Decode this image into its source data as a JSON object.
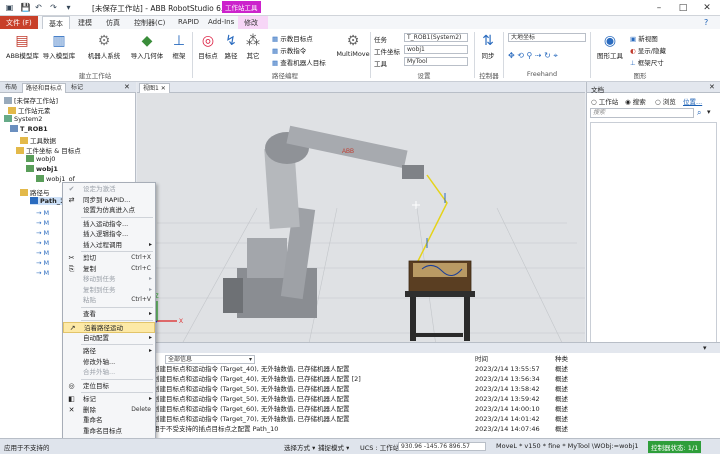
{
  "window": {
    "title": "[未保存工作站] - ABB RobotStudio 6.08",
    "context_badge": "工作站工具",
    "minimize": "–",
    "maximize": "□",
    "close": "✕"
  },
  "tabs": [
    "文件 (F)",
    "基本",
    "建模",
    "仿真",
    "控制器(C)",
    "RAPID",
    "Add-Ins",
    "修改"
  ],
  "ribbon": {
    "groups": {
      "build": "建立工作站",
      "path": "路径编程",
      "settings": "设置",
      "controller": "控制器",
      "freehand": "Freehand",
      "graphics": "图形"
    },
    "buttons": {
      "abb_library": "ABB模型库",
      "import_library": "导入模型库",
      "robot_system": "机器人系统",
      "import_geometry": "导入几何体",
      "frame": "框架",
      "target": "目标点",
      "path": "路径",
      "other": "其它",
      "teach_target": "示教目标点",
      "teach_instruction": "示教指令",
      "view_target": "查看机器人目标",
      "multimove": "MultiMove",
      "sync": "同步",
      "graphics_tools": "图形工具",
      "new_view": "新视图",
      "show_hide": "显示/隐藏",
      "frame_size": "框架尺寸"
    },
    "settings": {
      "task_label": "任务",
      "task_value": "T_ROB1(System2)",
      "wobj_label": "工件坐标",
      "wobj_value": "wobj1",
      "tool_label": "工具",
      "tool_value": "MyTool"
    },
    "freehand_ref": "大地坐标"
  },
  "left_panel": {
    "tabs": [
      "布局",
      "路径和目标点",
      "标记"
    ],
    "tree": [
      "[未保存工作站]",
      "工作站元素",
      "System2",
      "T_ROB1",
      "工具数据",
      "工件坐标 & 目标点",
      "wobj0",
      "wobj1",
      "wobj1_of",
      "路径与",
      "Path_10"
    ],
    "path_items": [
      "M",
      "M",
      "M",
      "M",
      "M",
      "M",
      "M"
    ]
  },
  "viewport": {
    "tab": "视图1"
  },
  "right_panel": {
    "title": "文档",
    "radio_station": "工作站",
    "radio_search": "搜索",
    "radio_browse": "浏览",
    "position": "位置...",
    "search_placeholder": "搜索"
  },
  "output": {
    "header_source": "来自",
    "header_filter": "全部信息",
    "header_time": "时间",
    "header_category": "种类",
    "rows": [
      {
        "msg": "创建目标点和运动指令 (Target_40), 无外轴数值, 已存储机器人配置",
        "time": "2023/2/14 13:55:57",
        "cat": "概述"
      },
      {
        "msg": "创建目标点和运动指令 (Target_40), 无外轴数值, 已存储机器人配置 [2]",
        "time": "2023/2/14 13:56:34",
        "cat": "概述"
      },
      {
        "msg": "创建目标点和运动指令 (Target_50), 无外轴数值, 已存储机器人配置",
        "time": "2023/2/14 13:58:42",
        "cat": "概述"
      },
      {
        "msg": "创建目标点和运动指令 (Target_50), 无外轴数值, 已存储机器人配置",
        "time": "2023/2/14 13:59:42",
        "cat": "概述"
      },
      {
        "msg": "创建目标点和运动指令 (Target_60), 无外轴数值, 已存储机器人配置",
        "time": "2023/2/14 14:00:10",
        "cat": "概述"
      },
      {
        "msg": "创建目标点和运动指令 (Target_70), 无外轴数值, 已存储机器人配置",
        "time": "2023/2/14 14:01:42",
        "cat": "概述"
      },
      {
        "msg": "用于不受支持的插点目标点之配置 Path_10",
        "time": "2023/2/14 14:07:46",
        "cat": "概述"
      }
    ]
  },
  "context_menu": [
    {
      "label": "设定为激活",
      "icon": "✔",
      "dis": true
    },
    {
      "label": "同步到 RAPID...",
      "icon": "⇄"
    },
    {
      "label": "设置为仿真进入点",
      "icon": ""
    },
    {
      "sep": true
    },
    {
      "label": "插入运动指令...",
      "icon": ""
    },
    {
      "label": "插入逻辑指令...",
      "icon": ""
    },
    {
      "label": "插入过程调用",
      "icon": "",
      "sub": true
    },
    {
      "sep": true
    },
    {
      "label": "剪切",
      "icon": "✂",
      "shortcut": "Ctrl+X"
    },
    {
      "label": "复制",
      "icon": "⎘",
      "shortcut": "Ctrl+C"
    },
    {
      "label": "移动到任务",
      "icon": "",
      "dis": true,
      "sub": true
    },
    {
      "label": "复制到任务",
      "icon": "",
      "dis": true,
      "sub": true
    },
    {
      "label": "粘贴",
      "icon": "",
      "dis": true,
      "shortcut": "Ctrl+V"
    },
    {
      "sep": true
    },
    {
      "label": "查看",
      "icon": "",
      "sub": true
    },
    {
      "sep": true
    },
    {
      "label": "沿着路径运动",
      "icon": "↗",
      "hl": true
    },
    {
      "label": "自动配置",
      "icon": "",
      "sub": true
    },
    {
      "sep": true
    },
    {
      "label": "路径",
      "icon": "",
      "sub": true
    },
    {
      "label": "修改外轴...",
      "icon": ""
    },
    {
      "label": "合并外轴...",
      "icon": "",
      "dis": true
    },
    {
      "sep": true
    },
    {
      "label": "定位目标",
      "icon": "◎"
    },
    {
      "sep": true
    },
    {
      "label": "标记",
      "icon": "◧",
      "sub": true
    },
    {
      "label": "删除",
      "icon": "✕",
      "shortcut": "Delete"
    },
    {
      "label": "重命名",
      "icon": ""
    },
    {
      "label": "重命名目标点",
      "icon": ""
    }
  ],
  "status": {
    "left_msg": "应用于不支持的",
    "select_mode": "选择方式",
    "snap_mode": "捕捉模式",
    "ucs": "UCS : 工作站",
    "coords": "930.96  -145.76  896.57",
    "motion": "MoveL * v150 * fine * MyTool \\WObj:=wobj1",
    "controller_status": "控制器状态: 1/1"
  },
  "colors": {
    "file_tab": "#c8402a",
    "highlight": "#fde9a6",
    "controller_ok": "#2e9e3a",
    "path_yellow": "#e5d31a",
    "robot_gray": "#8a8d92"
  }
}
